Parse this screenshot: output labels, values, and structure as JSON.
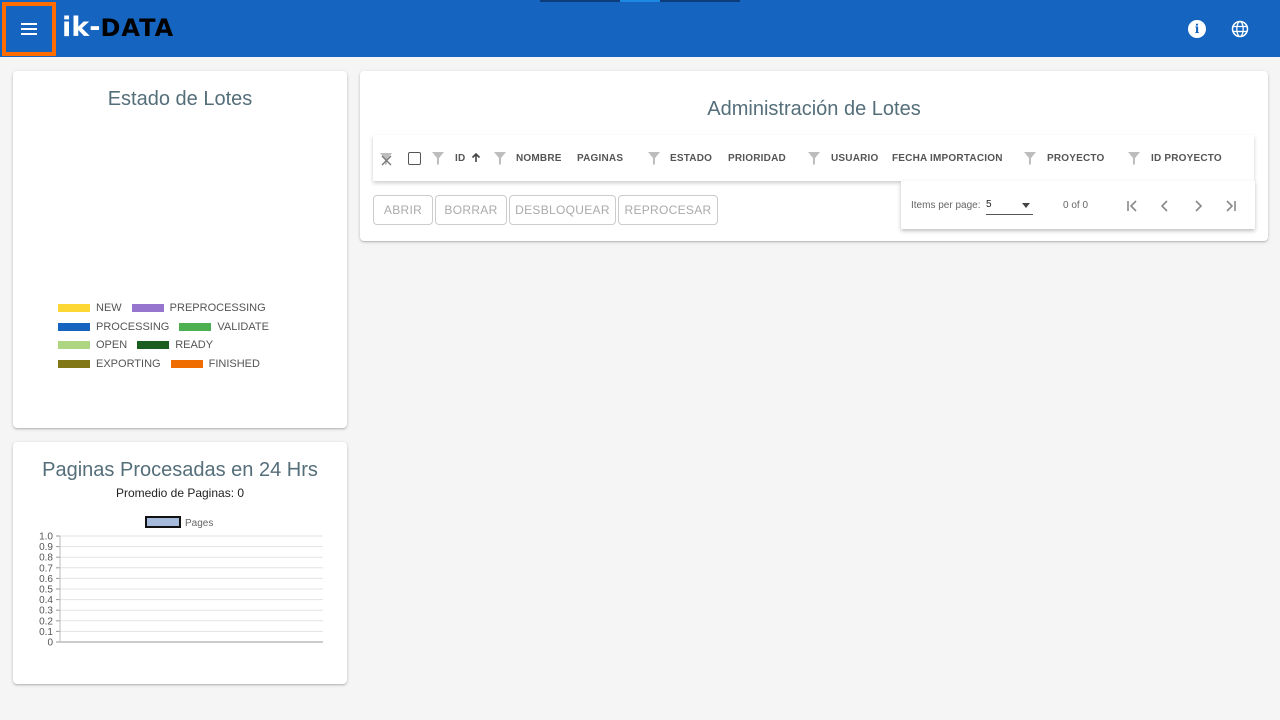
{
  "header": {
    "logo_ik": "ik",
    "logo_dash": "-",
    "logo_data": "DATA",
    "info_glyph": "i",
    "accent": "#1565c0",
    "highlight": "#ff6d00"
  },
  "estado": {
    "title": "Estado de Lotes",
    "legend": [
      {
        "label": "NEW",
        "color": "#fdd835"
      },
      {
        "label": "PREPROCESSING",
        "color": "#9575cd"
      },
      {
        "label": "PROCESSING",
        "color": "#1565c0"
      },
      {
        "label": "VALIDATE",
        "color": "#4caf50"
      },
      {
        "label": "OPEN",
        "color": "#aed581"
      },
      {
        "label": "READY",
        "color": "#1b5e20"
      },
      {
        "label": "EXPORTING",
        "color": "#827717"
      },
      {
        "label": "FINISHED",
        "color": "#ef6c00"
      }
    ]
  },
  "paginas": {
    "title": "Paginas Procesadas en 24 Hrs",
    "promedio": "Promedio de Paginas: 0",
    "chart_data": {
      "type": "line",
      "series": [
        {
          "name": "Pages",
          "values": []
        }
      ],
      "y_ticks": [
        "1.0",
        "0.9",
        "0.8",
        "0.7",
        "0.6",
        "0.5",
        "0.4",
        "0.3",
        "0.2",
        "0.1",
        "0"
      ],
      "ylim": [
        0,
        1
      ],
      "grid": true,
      "legend": "top-center",
      "legend_color": "#a6bbdc"
    }
  },
  "admin": {
    "title": "Administración de Lotes",
    "columns": {
      "id": "ID",
      "nombre": "NOMBRE",
      "paginas": "PAGINAS",
      "estado": "ESTADO",
      "prioridad": "PRIORIDAD",
      "usuario": "USUARIO",
      "fecha": "FECHA IMPORTACION",
      "proyecto": "PROYECTO",
      "id_proyecto": "ID PROYECTO"
    },
    "buttons": {
      "abrir": "ABRIR",
      "borrar": "BORRAR",
      "desbloquear": "DESBLOQUEAR",
      "reprocesar": "REPROCESAR"
    },
    "paginator": {
      "items_label": "Items per page:",
      "items_value": "5",
      "range": "0 of 0"
    }
  }
}
